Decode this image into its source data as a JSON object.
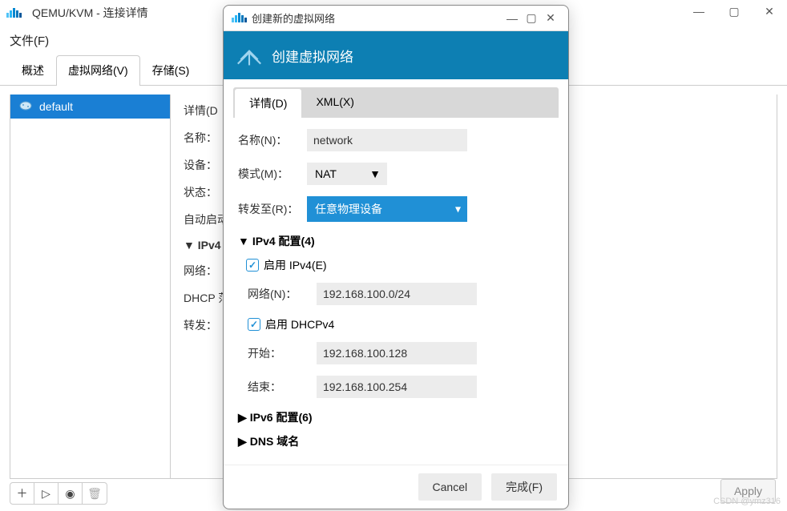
{
  "main": {
    "title": "QEMU/KVM - 连接详情",
    "menu_file": "文件(F)",
    "tabs": {
      "overview": "概述",
      "virtual_networks": "虚拟网络(V)",
      "storage": "存储(S)"
    },
    "sidebar": {
      "default_item": "default"
    },
    "details": {
      "tab_label": "详情(D",
      "name_label": "名称：",
      "device_label": "设备：",
      "state_label": "状态：",
      "autostart_label": "自动启动",
      "ipv4_header": "IPv4",
      "network_label": "网络：",
      "dhcp_label": "DHCP 范",
      "forward_label": "转发："
    },
    "apply_label": "Apply"
  },
  "dialog": {
    "window_title": "创建新的虚拟网络",
    "header_title": "创建虚拟网络",
    "tabs": {
      "details": "详情(D)",
      "xml": "XML(X)"
    },
    "form": {
      "name_label": "名称(N)：",
      "name_value": "network",
      "mode_label": "模式(M)：",
      "mode_value": "NAT",
      "forward_label": "转发至(R)：",
      "forward_value": "任意物理设备",
      "ipv4_section": "IPv4 配置(4)",
      "enable_ipv4": "启用 IPv4(E)",
      "net_label": "网络(N)：",
      "net_value": "192.168.100.0/24",
      "enable_dhcpv4": "启用 DHCPv4",
      "start_label": "开始：",
      "start_value": "192.168.100.128",
      "end_label": "结束：",
      "end_value": "192.168.100.254",
      "ipv6_section": "IPv6 配置(6)",
      "dns_section": "DNS 域名"
    },
    "buttons": {
      "cancel": "Cancel",
      "finish": "完成(F)"
    }
  },
  "watermark": "CSDN @ymz316"
}
